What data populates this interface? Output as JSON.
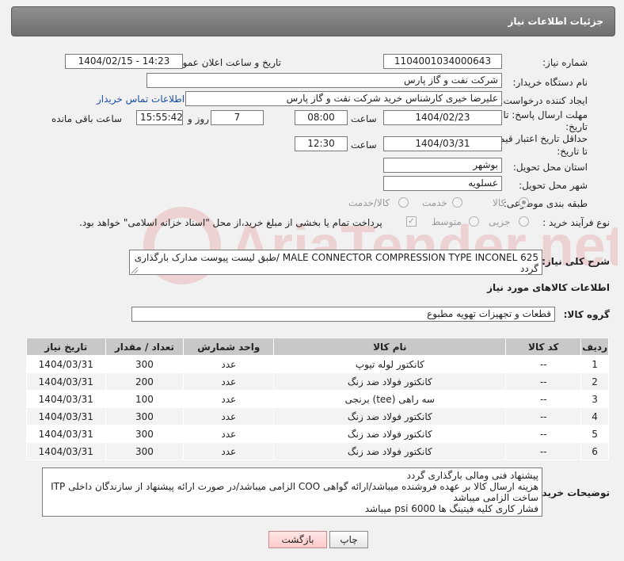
{
  "header": {
    "title": "جزئیات اطلاعات نیاز"
  },
  "form": {
    "need_number_label": "شماره نیاز:",
    "need_number": "1104001034000643",
    "announce_label": "تاریخ و ساعت اعلان عمومی:",
    "announce_value": "1404/02/15 - 14:23",
    "buyer_org_label": "نام دستگاه خریدار:",
    "buyer_org": "شرکت نفت و گاز پارس",
    "creator_label": "ایجاد کننده درخواست:",
    "creator": "علیرضا  خیری کارشناس خرید  شرکت نفت و گاز پارس",
    "contact_link": "اطلاعات تماس خریدار",
    "reply_deadline_label_1": "مهلت ارسال پاسخ: تا",
    "reply_deadline_label_2": "تاریخ:",
    "reply_date": "1404/02/23",
    "time_label": "ساعت",
    "reply_time": "08:00",
    "days": "7",
    "days_label": "روز و",
    "remaining": "15:55:42",
    "remaining_label": "ساعت باقی مانده",
    "price_validity_label_1": "حداقل تاریخ اعتبار قیمت:",
    "price_validity_label_2": "تا تاریخ:",
    "price_date": "1404/03/31",
    "price_time": "12:30",
    "province_label": "استان محل تحویل:",
    "province": "بوشهر",
    "city_label": "شهر محل تحویل:",
    "city": "عسلویه",
    "category_label": "طبقه بندی موضوعی:",
    "category_options": [
      "کالا",
      "خدمت",
      "کالا/خدمت"
    ],
    "process_label": "نوع فرآیند خرید :",
    "process_options": [
      "جزیی",
      "متوسط"
    ],
    "treasury_note": "پرداخت تمام یا بخشی از مبلغ خرید،از محل \"اسناد خزانه اسلامی\" خواهد بود.",
    "description_label": "شرح کلی نیاز:",
    "description": "MALE CONNECTOR COMPRESSION TYPE INCONEL 625 /طبق لیست پیوست مدارک بارگذاری گردد",
    "goods_info_title": "اطلاعات کالاهای مورد نیاز",
    "goods_group_label": "گروه کالا:",
    "goods_group": "قطعات و تجهیزات تهویه مطبوع"
  },
  "table": {
    "headers": [
      "ردیف",
      "کد کالا",
      "نام کالا",
      "واحد شمارش",
      "تعداد / مقدار",
      "تاریخ نیاز"
    ],
    "rows": [
      [
        "1",
        "--",
        "کانکتور لوله تیوپ",
        "عدد",
        "300",
        "1404/03/31"
      ],
      [
        "2",
        "--",
        "کانکتور فولاد ضد زنگ",
        "عدد",
        "200",
        "1404/03/31"
      ],
      [
        "3",
        "--",
        "سه راهی (tee) برنجی",
        "عدد",
        "100",
        "1404/03/31"
      ],
      [
        "4",
        "--",
        "کانکتور فولاد ضد زنگ",
        "عدد",
        "300",
        "1404/03/31"
      ],
      [
        "5",
        "--",
        "کانکتور فولاد ضد زنگ",
        "عدد",
        "300",
        "1404/03/31"
      ],
      [
        "6",
        "--",
        "کانکتور فولاد ضد زنگ",
        "عدد",
        "300",
        "1404/03/31"
      ]
    ]
  },
  "notes": {
    "label": "توضیحات خریدار:",
    "lines": [
      "پیشنهاد فنی ومالی بارگذاری گردد",
      "هزینه ارسال کالا بر عهده فروشنده میباشد/ارائه گواهی COO الزامی میباشد/در صورت ارائه پیشنهاد از سازندگان داخلی ITP ساخت الزامی میباشد",
      "فشار کاری کلیه فیتینگ ها psi 6000 میباشد"
    ]
  },
  "buttons": {
    "print": "چاپ",
    "back": "بازگشت"
  },
  "watermark_text": "AriaTender.net"
}
